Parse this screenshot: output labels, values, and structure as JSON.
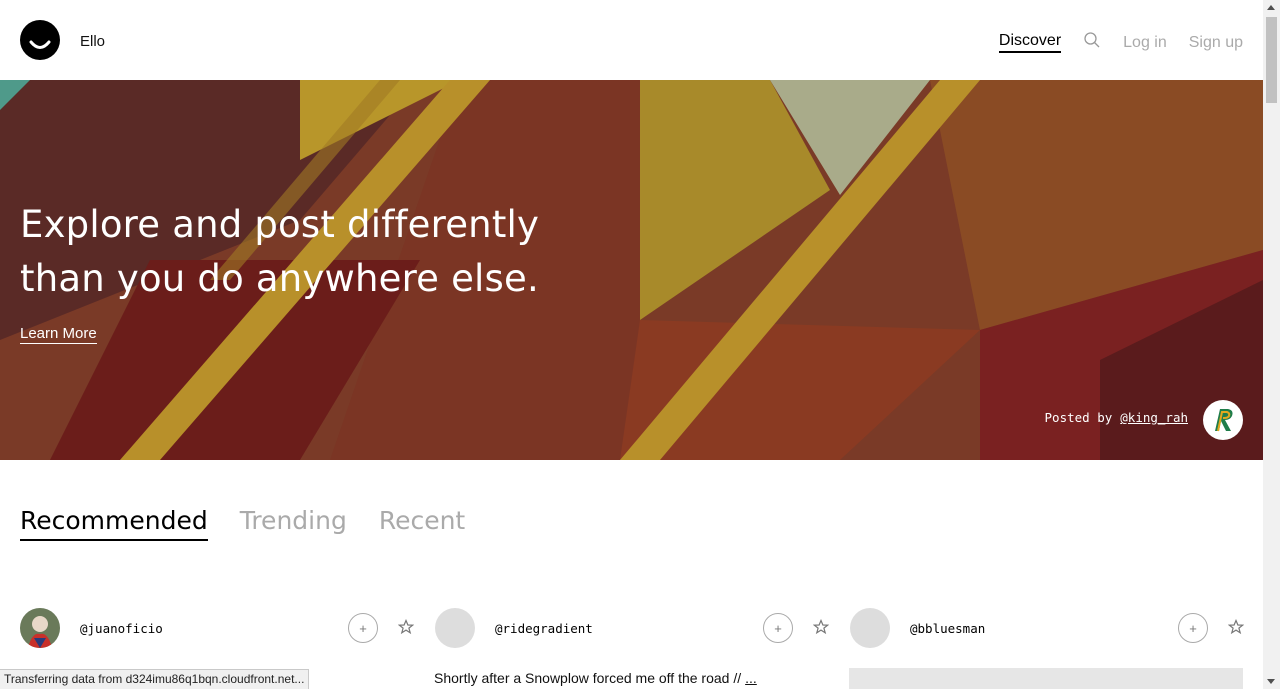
{
  "header": {
    "brand": "Ello",
    "nav": {
      "discover": "Discover",
      "login": "Log in",
      "signup": "Sign up"
    }
  },
  "hero": {
    "title_line1": "Explore and post differently",
    "title_line2": "than you do anywhere else.",
    "learn_more": "Learn More",
    "posted_by_label": "Posted by",
    "posted_by_user": "@king_rah"
  },
  "tabs": [
    "Recommended",
    "Trending",
    "Recent"
  ],
  "cards": [
    {
      "username": "@juanoficio",
      "follow": "+"
    },
    {
      "username": "@ridegradient",
      "follow": "+"
    },
    {
      "username": "@bbluesman",
      "follow": "+"
    }
  ],
  "excerpt": {
    "text": "Shortly after a Snowplow forced me off the road //",
    "more": "..."
  },
  "status": "Transferring data from d324imu86q1bqn.cloudfront.net...",
  "colors": {
    "accent": "#000000",
    "muted": "#aaaaaa"
  }
}
